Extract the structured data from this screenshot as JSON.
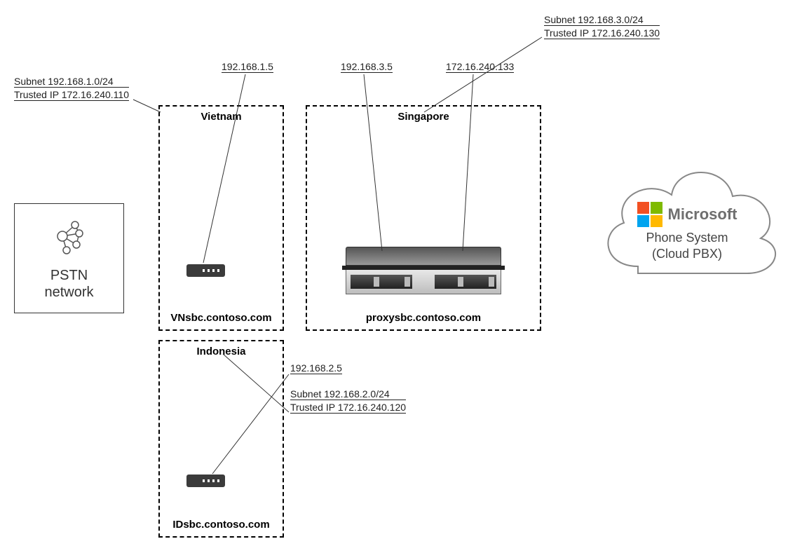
{
  "pstn": {
    "label_line1": "PSTN",
    "label_line2": "network"
  },
  "regions": {
    "vietnam": {
      "title": "Vietnam",
      "hostname": "VNsbc.contoso.com",
      "device_ip": "192.168.1.5",
      "subnet": "Subnet 192.168.1.0/24",
      "trusted_ip": "Trusted IP 172.16.240.110"
    },
    "singapore": {
      "title": "Singapore",
      "hostname": "proxysbc.contoso.com",
      "device_ip_internal": "192.168.3.5",
      "device_ip_external": "172.16.240.133",
      "subnet": "Subnet 192.168.3.0/24",
      "trusted_ip": "Trusted IP 172.16.240.130"
    },
    "indonesia": {
      "title": "Indonesia",
      "hostname": "IDsbc.contoso.com",
      "device_ip": "192.168.2.5",
      "subnet": "Subnet 192.168.2.0/24",
      "trusted_ip": "Trusted IP 172.16.240.120"
    }
  },
  "cloud": {
    "brand": "Microsoft",
    "line1": "Phone System",
    "line2": "(Cloud PBX)"
  }
}
